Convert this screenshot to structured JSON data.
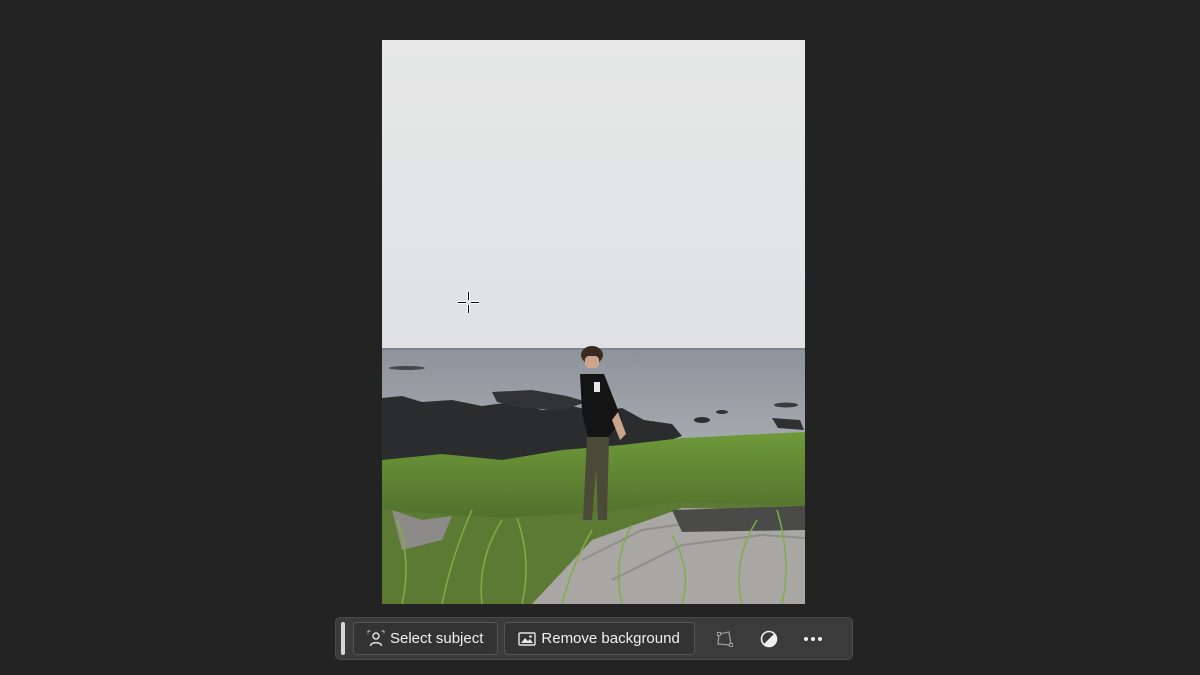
{
  "taskbar": {
    "select_subject_label": "Select subject",
    "remove_background_label": "Remove background",
    "icons": {
      "select_subject": "person-selection-icon",
      "remove_background": "image-icon",
      "transform": "transform-icon",
      "adjustment": "contrast-circle-icon",
      "more": "more-horizontal-icon"
    }
  },
  "colors": {
    "app_background": "#232323",
    "taskbar_background": "#3b3b3b",
    "button_text": "#f0f0f0"
  }
}
